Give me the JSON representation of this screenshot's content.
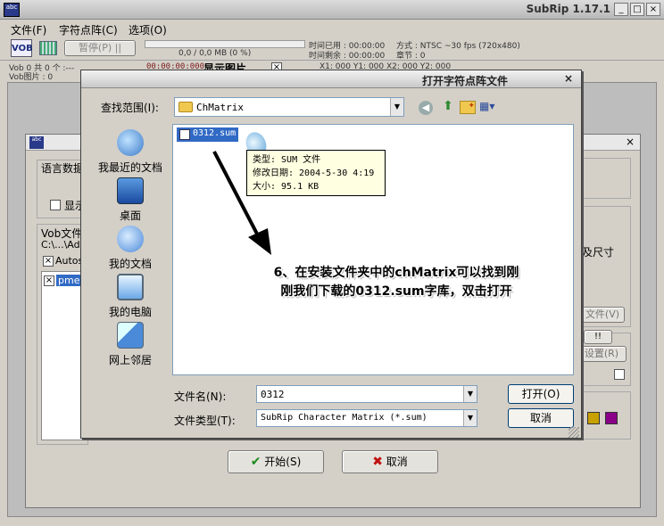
{
  "app": {
    "title": "SubRip 1.17.1",
    "logo_text": "abc",
    "window_buttons": [
      "_",
      "□",
      "×"
    ]
  },
  "menu": {
    "items": [
      "文件(F)",
      "字符点阵(C)",
      "选项(O)"
    ]
  },
  "toolbar": {
    "vob_label": "VOB",
    "pause_label": "暂停(P) ||",
    "progress_text": "0,0 / 0,0 MB (0 %)",
    "time_used": "时间已用 : 00:00:00",
    "time_left": "时间剩余 : 00:00:00",
    "format": "方式 : NTSC ~30 fps (720x480)",
    "chapter": "章节 : 0"
  },
  "statusrow": {
    "vob_count": "Vob 0  共 0  个 :---",
    "vob_image": "Vob图片 : 0",
    "time_red": "00:00:00:000",
    "show_image": "显示图片",
    "coords": "X1: 000  Y1: 000  X2: 000  Y2: 000"
  },
  "bg_dialog": {
    "language_label": "语言数据",
    "show_label": "显示",
    "vob_files_label": "Vob文件",
    "path_label": "C:\\...\\Ad",
    "autos_label": "Autos",
    "pme_label": "pme-",
    "size_label": "及尺寸",
    "file_btn": "文件(V)",
    "bang_btn": "!!",
    "reset_btn": "设置(R)",
    "start_btn": "开始(S)",
    "cancel_btn": "取消",
    "color1": "#c8a000",
    "color2": "#8a0088"
  },
  "dialog": {
    "title": "打开字符点阵文件",
    "lookin_label": "查找范围(I):",
    "lookin_value": "ChMatrix",
    "places": [
      {
        "label": "我最近的文档"
      },
      {
        "label": "桌面"
      },
      {
        "label": "我的文档"
      },
      {
        "label": "我的电脑"
      },
      {
        "label": "网上邻居"
      }
    ],
    "file": {
      "name": "0312.sum"
    },
    "tooltip": {
      "type": "类型: SUM 文件",
      "modified": "修改日期: 2004-5-30 4:19",
      "size": "大小: 95.1 KB"
    },
    "instruction_line1": "6、在安装文件夹中的chMatrix可以找到刚",
    "instruction_line2": "刚我们下载的0312.sum字库，双击打开",
    "filename_label": "文件名(N):",
    "filename_value": "0312",
    "filetype_label": "文件类型(T):",
    "filetype_value": "SubRip Character Matrix (*.sum)",
    "open_btn": "打开(O)",
    "cancel_btn": "取消"
  }
}
